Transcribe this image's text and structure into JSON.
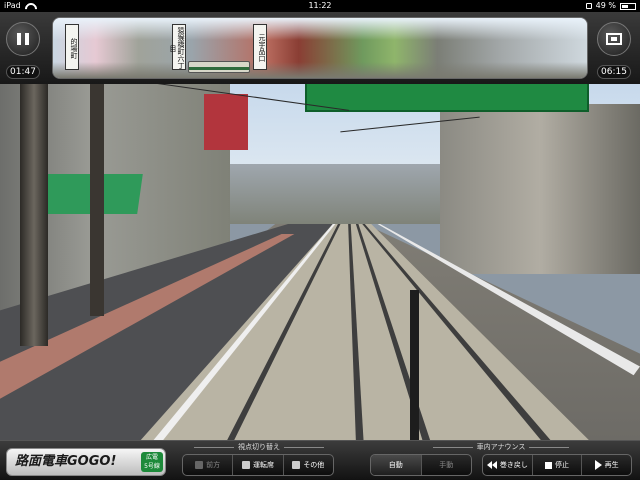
{
  "status_bar": {
    "device": "iPad",
    "time": "11:22",
    "battery_percent": "49 %",
    "battery_level": 0.49
  },
  "player": {
    "elapsed": "01:47",
    "remaining": "06:15"
  },
  "route": {
    "stops": [
      {
        "label": "的場町"
      },
      {
        "label": "猿猴橋町六丁目"
      },
      {
        "label": "元宇品口"
      }
    ]
  },
  "bottom": {
    "logo_text": "路面電車GOGO!",
    "logo_badge_line1": "広電",
    "logo_badge_line2": "5号線",
    "view_group_label": "視点切り替え",
    "view_buttons": [
      {
        "label": "前方",
        "state": "dim"
      },
      {
        "label": "運転席",
        "state": "normal"
      },
      {
        "label": "その他",
        "state": "normal"
      }
    ],
    "announce_group_label": "車内アナウンス",
    "announce_buttons": [
      {
        "label": "自動",
        "state": "active"
      },
      {
        "label": "手動",
        "state": "dim"
      }
    ],
    "playback_buttons": [
      {
        "label": "巻き戻し"
      },
      {
        "label": "停止"
      },
      {
        "label": "再生"
      }
    ]
  },
  "icons": {
    "pause": "pause-icon",
    "screen": "screen-mode-icon",
    "wifi": "wifi-icon",
    "lock": "rotation-lock-icon",
    "battery": "battery-icon"
  }
}
